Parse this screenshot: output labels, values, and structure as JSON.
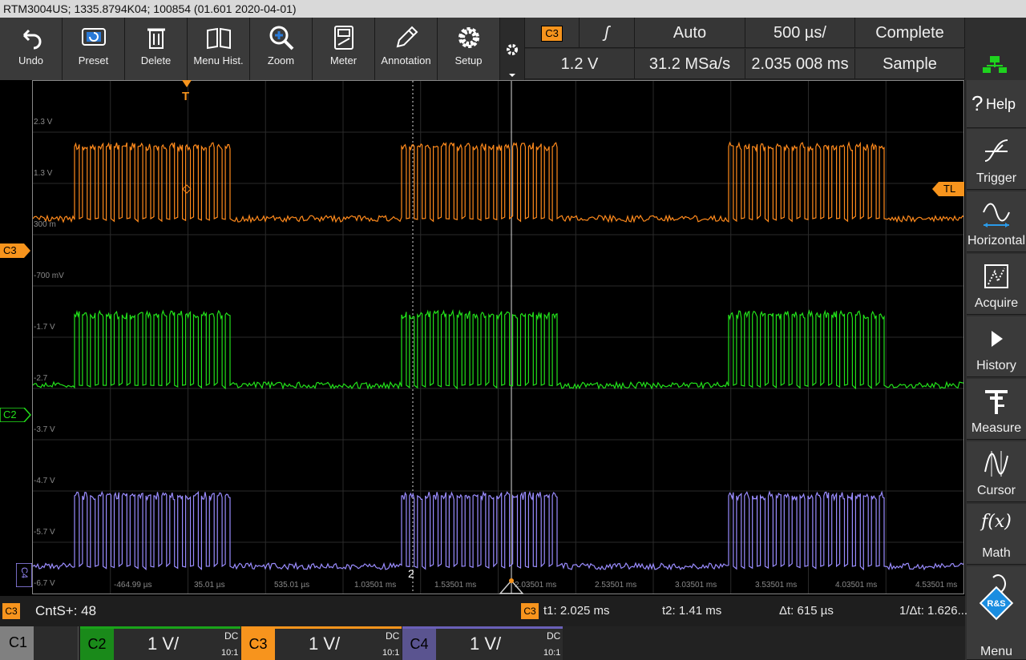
{
  "title": "RTM3004US; 1335.8794K04; 100854 (01.601 2020-04-01)",
  "toolbar": {
    "undo": "Undo",
    "preset": "Preset",
    "delete": "Delete",
    "menu_hist": "Menu Hist.",
    "zoom": "Zoom",
    "meter": "Meter",
    "annotation": "Annotation",
    "setup": "Setup"
  },
  "trigger_panel": {
    "source": "C3",
    "slope": "ʃ",
    "level": "1.2 V",
    "mode": "Auto",
    "timebase": "500 µs/",
    "sample_rate": "31.2 MSa/s",
    "record_length": "2.035 008 ms",
    "acq_state": "Complete",
    "acq_mode": "Sample"
  },
  "sidebar": {
    "help": "Help",
    "trigger": "Trigger",
    "horizontal": "Horizontal",
    "acquire": "Acquire",
    "history": "History",
    "measure": "Measure",
    "cursor": "Cursor",
    "math": "Math",
    "menu": "Menu"
  },
  "grid": {
    "trigger_marker": "T",
    "level_marker": "TL",
    "cursor2_label": "2",
    "volt_labels": [
      "2.3 V",
      "1.3 V",
      "300 m",
      "-700 mV",
      "-1.7 V",
      "-2.7",
      "-3.7 V",
      "-4.7 V",
      "-5.7 V",
      "-6.7 V"
    ],
    "time_labels": [
      "-464.99 µs",
      "35.01 µs",
      "535.01 µs",
      "1.03501 ms",
      "1.53501 ms",
      "2.03501 ms",
      "2.53501 ms",
      "3.03501 ms",
      "3.53501 ms",
      "4.03501 ms",
      "4.53501 ms"
    ],
    "markers": {
      "c3": "C3",
      "c2": "C2",
      "c4": "C4"
    }
  },
  "status": {
    "channel": "C3",
    "counter": "CntS+: 48",
    "cursor_channel": "C3",
    "t1": "t1: 2.025 ms",
    "t2": "t2: 1.41 ms",
    "dt": "Δt: 615 µs",
    "inv_dt": "1/Δt: 1.626..."
  },
  "channels": [
    {
      "name": "C1",
      "scale": "",
      "coupling": "",
      "probe": ""
    },
    {
      "name": "C2",
      "scale": "1 V/",
      "coupling": "DC",
      "probe": "10:1"
    },
    {
      "name": "C3",
      "scale": "1 V/",
      "coupling": "DC",
      "probe": "10:1"
    },
    {
      "name": "C4",
      "scale": "1 V/",
      "coupling": "DC",
      "probe": "10:1"
    }
  ],
  "colors": {
    "c2": "#22e01a",
    "c3": "#ff8a1c",
    "c4": "#9a8cff",
    "accent_orange": "#f7941d"
  },
  "waveform": {
    "bursts_count": 3,
    "pulses_per_burst": 20
  }
}
